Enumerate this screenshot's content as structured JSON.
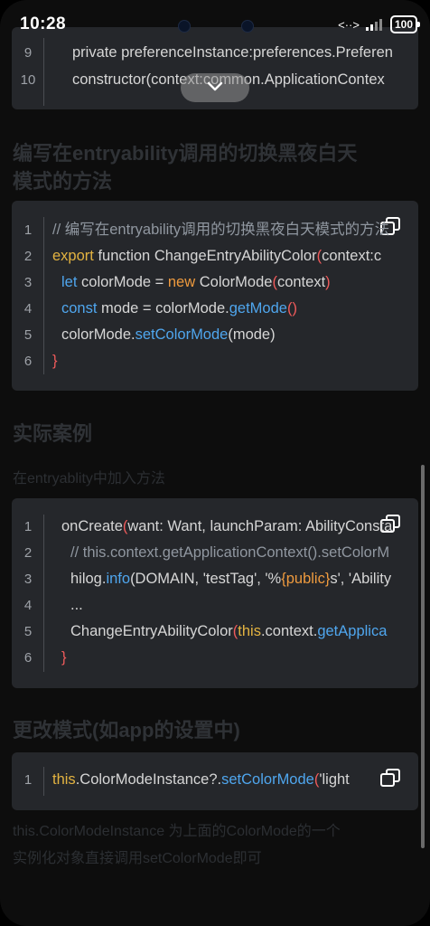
{
  "status_bar": {
    "time": "10:28",
    "signal_text": "<··>",
    "battery": "100"
  },
  "headings": {
    "h1": "编写在entryability调用的切换黑夜白天",
    "h1b": "模式的方法",
    "h2": "实际案例",
    "h3": "更改模式(如app的设置中)"
  },
  "paragraphs": {
    "p1": "在entryablity中加入方法",
    "p2a": "this.ColorModeInstance 为上面的ColorMode的一个",
    "p2b": "实例化对象直接调用setColorMode即可"
  },
  "code_blocks": [
    {
      "lines": [
        {
          "num": "9",
          "text": "private preferenceInstance:preferences.Preferen"
        },
        {
          "num": "10",
          "text": "constructor(context:common.ApplicationContex"
        }
      ]
    },
    {
      "lines": [
        {
          "num": "1"
        },
        {
          "num": "2"
        },
        {
          "num": "3"
        },
        {
          "num": "4"
        },
        {
          "num": "5"
        },
        {
          "num": "6"
        }
      ]
    },
    {
      "lines": [
        {
          "num": "1"
        },
        {
          "num": "2"
        },
        {
          "num": "3"
        },
        {
          "num": "4"
        },
        {
          "num": "5"
        },
        {
          "num": "6"
        }
      ]
    },
    {
      "lines": [
        {
          "num": "1"
        }
      ]
    }
  ],
  "code": {
    "b2_l1": "// 编写在entryability调用的切换黑夜白天模式的方法",
    "b2_l2a": "export",
    "b2_l2b": " function ChangeEntryAbilityColor",
    "b2_l2c": "(",
    "b2_l2d": "context:c",
    "b2_l3a": "let",
    "b2_l3b": " colorMode = ",
    "b2_l3c": "new",
    "b2_l3d": " ColorMode",
    "b2_l3e": "(",
    "b2_l3f": "context",
    "b2_l3g": ")",
    "b2_l4a": "const",
    "b2_l4b": " mode = colorMode.",
    "b2_l4c": "getMode",
    "b2_l4d": "()",
    "b2_l5a": "colorMode.",
    "b2_l5b": "setColorMode",
    "b2_l5c": "(mode)",
    "b2_l6": "}",
    "b3_l1a": "onCreate",
    "b3_l1b": "(",
    "b3_l1c": "want: Want, launchParam: AbilityConsta",
    "b3_l2": "// this.context.getApplicationContext().setColorM",
    "b3_l3a": "hilog.",
    "b3_l3b": "info",
    "b3_l3c": "(DOMAIN, 'testTag', '%",
    "b3_l3d": "{public}",
    "b3_l3e": "s', 'Ability",
    "b3_l4": "...",
    "b3_l5a": "ChangeEntryAbilityColor",
    "b3_l5b": "(",
    "b3_l5c": "this",
    "b3_l5d": ".context.",
    "b3_l5e": "getApplica",
    "b3_l6": "}",
    "b4_l1a": "this",
    "b4_l1b": ".ColorModeInstance?.",
    "b4_l1c": "setColorMode",
    "b4_l1d": "(",
    "b4_l1e": "'light"
  },
  "colors": {
    "background": "#0d0d0d",
    "code_bg": "#25272b",
    "keyword": "#e3b341",
    "function": "#4fa6ee",
    "bracket": "#f05b5b"
  }
}
